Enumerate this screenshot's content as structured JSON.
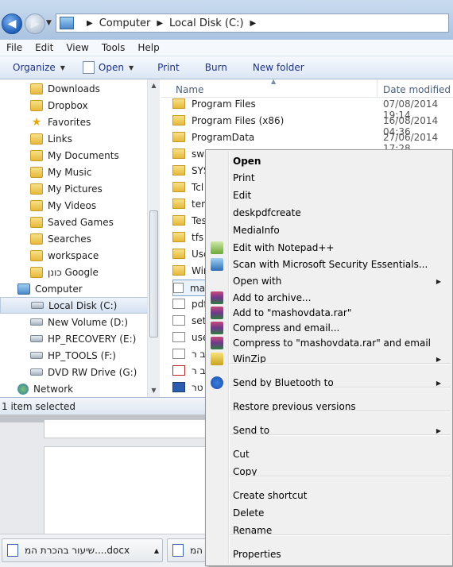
{
  "address": {
    "segments": [
      "Computer",
      "Local Disk (C:)"
    ]
  },
  "menubar": [
    "File",
    "Edit",
    "View",
    "Tools",
    "Help"
  ],
  "commands": {
    "organize": "Organize",
    "open": "Open",
    "print": "Print",
    "burn": "Burn",
    "new_folder": "New folder"
  },
  "nav": [
    {
      "label": "Downloads",
      "icon": "downloads-folder-icon"
    },
    {
      "label": "Dropbox",
      "icon": "dropbox-folder-icon"
    },
    {
      "label": "Favorites",
      "icon": "favorites-star-icon"
    },
    {
      "label": "Links",
      "icon": "links-folder-icon"
    },
    {
      "label": "My Documents",
      "icon": "documents-folder-icon"
    },
    {
      "label": "My Music",
      "icon": "music-folder-icon"
    },
    {
      "label": "My Pictures",
      "icon": "pictures-folder-icon"
    },
    {
      "label": "My Videos",
      "icon": "videos-folder-icon"
    },
    {
      "label": "Saved Games",
      "icon": "saved-games-folder-icon"
    },
    {
      "label": "Searches",
      "icon": "searches-folder-icon"
    },
    {
      "label": "workspace",
      "icon": "folder-icon"
    },
    {
      "label": "כונן Google",
      "icon": "google-drive-folder-icon"
    },
    {
      "label": "Computer",
      "icon": "computer-icon"
    },
    {
      "label": "Local Disk (C:)",
      "icon": "windows-drive-icon",
      "selected": true
    },
    {
      "label": "New Volume (D:)",
      "icon": "drive-icon"
    },
    {
      "label": "HP_RECOVERY (E:)",
      "icon": "drive-icon"
    },
    {
      "label": "HP_TOOLS (F:)",
      "icon": "drive-icon"
    },
    {
      "label": "DVD RW Drive (G:)",
      "icon": "dvd-drive-icon"
    },
    {
      "label": "Network",
      "icon": "network-icon"
    }
  ],
  "columns": {
    "name": "Name",
    "date": "Date modified"
  },
  "files": [
    {
      "name": "Program Files",
      "date": "07/08/2014 19:14",
      "icon": "folder-icon"
    },
    {
      "name": "Program Files (x86)",
      "date": "16/08/2014 04:36",
      "icon": "folder-icon"
    },
    {
      "name": "ProgramData",
      "date": "27/06/2014 17:28",
      "icon": "folder-icon"
    },
    {
      "name": "sws",
      "date": "",
      "icon": "folder-icon"
    },
    {
      "name": "SYS",
      "date": "",
      "icon": "folder-icon"
    },
    {
      "name": "Tcl",
      "date": "",
      "icon": "folder-icon"
    },
    {
      "name": "tem",
      "date": "",
      "icon": "folder-icon"
    },
    {
      "name": "Tes",
      "date": "",
      "icon": "folder-icon"
    },
    {
      "name": "tfs",
      "date": "",
      "icon": "folder-icon"
    },
    {
      "name": "Use",
      "date": "",
      "icon": "folder-icon"
    },
    {
      "name": "Win",
      "date": "",
      "icon": "folder-icon"
    },
    {
      "name": "ma",
      "date": "",
      "icon": "document-icon",
      "selected": true
    },
    {
      "name": "pdf",
      "date": "",
      "icon": "document-icon"
    },
    {
      "name": "set",
      "date": "",
      "icon": "document-icon"
    },
    {
      "name": "use",
      "date": "",
      "icon": "document-icon"
    },
    {
      "name": "ב ר",
      "date": "",
      "icon": "document-icon"
    },
    {
      "name": "ב ר",
      "date": "",
      "icon": "pdf-icon"
    },
    {
      "name": "טר",
      "date": "",
      "icon": "word-document-icon"
    }
  ],
  "status": "1 item selected",
  "downloads": [
    {
      "label": "שיעור בהכרת המ....docx"
    },
    {
      "label": "המ"
    }
  ],
  "context_menu": [
    {
      "label": "Open",
      "bold": true
    },
    {
      "label": "Print"
    },
    {
      "label": "Edit"
    },
    {
      "label": "deskpdfcreate"
    },
    {
      "label": "MediaInfo"
    },
    {
      "label": "Edit with Notepad++",
      "icon": "notepad-plus-plus-icon"
    },
    {
      "label": "Scan with Microsoft Security Essentials...",
      "icon": "security-essentials-icon"
    },
    {
      "label": "Open with",
      "submenu": true
    },
    {
      "label": "Add to archive...",
      "icon": "winrar-icon"
    },
    {
      "label": "Add to \"mashovdata.rar\"",
      "icon": "winrar-icon"
    },
    {
      "label": "Compress and email...",
      "icon": "winrar-icon"
    },
    {
      "label": "Compress to \"mashovdata.rar\" and email",
      "icon": "winrar-icon"
    },
    {
      "label": "WinZip",
      "icon": "winzip-icon",
      "submenu": true
    },
    {
      "label": "Send by Bluetooth to",
      "icon": "bluetooth-icon",
      "submenu": true
    },
    {
      "label": "Restore previous versions"
    },
    {
      "label": "Send to",
      "submenu": true
    },
    {
      "label": "Cut"
    },
    {
      "label": "Copy"
    },
    {
      "label": "Create shortcut"
    },
    {
      "label": "Delete"
    },
    {
      "label": "Rename"
    },
    {
      "label": "Properties"
    }
  ],
  "colors": {
    "accent": "#1e3287",
    "selection": "#d4e1f1",
    "menu_bg": "#f0f0f0"
  }
}
